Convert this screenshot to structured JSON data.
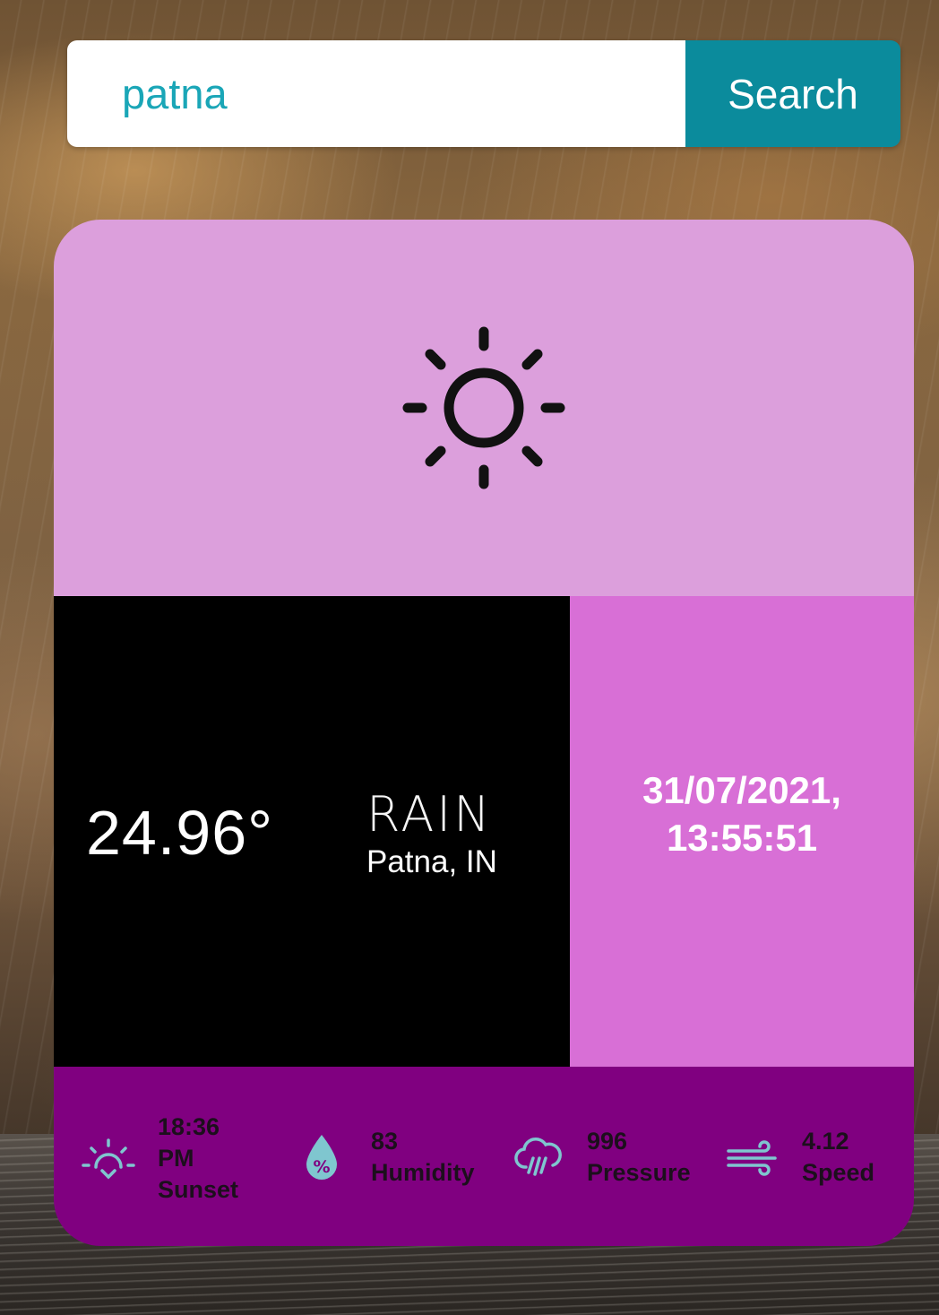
{
  "search": {
    "value": "patna",
    "button_label": "Search"
  },
  "weather": {
    "main_icon": "sun-icon",
    "temperature": "24.96°",
    "condition": "RAIN",
    "location": "Patna, IN",
    "date": "31/07/2021,",
    "time": "13:55:51"
  },
  "stats": [
    {
      "icon": "sunset-icon",
      "lines": [
        "18:36",
        "PM",
        "Sunset"
      ]
    },
    {
      "icon": "humidity-drop-icon",
      "lines": [
        "83",
        "Humidity"
      ]
    },
    {
      "icon": "rain-cloud-icon",
      "lines": [
        "996",
        "Pressure"
      ]
    },
    {
      "icon": "wind-icon",
      "lines": [
        "4.12",
        "Speed"
      ]
    }
  ],
  "colors": {
    "search_button": "#0b8b9c",
    "search_text": "#1aa6b7",
    "icon_panel": "#dc9fdc",
    "temp_panel": "#000000",
    "date_panel": "#d86fd6",
    "stats_panel": "#800080",
    "stat_icons": "#7fc6cf"
  }
}
